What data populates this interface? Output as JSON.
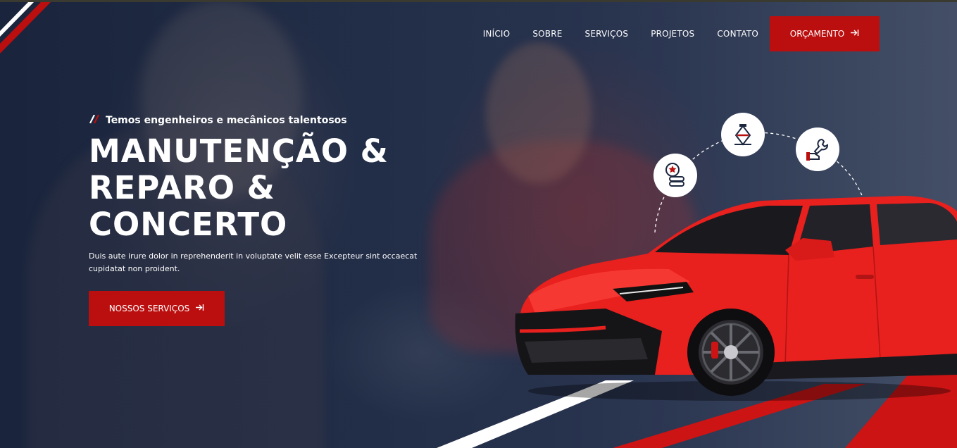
{
  "nav": {
    "items": [
      {
        "label": "INÍCIO"
      },
      {
        "label": "SOBRE"
      },
      {
        "label": "SERVIÇOS"
      },
      {
        "label": "PROJETOS"
      },
      {
        "label": "CONTATO"
      }
    ],
    "cta_label": "ORÇAMENTO",
    "cta_icon": "arrow-right-to-bracket-icon"
  },
  "hero": {
    "eyebrow": "Temos engenheiros e mecânicos talentosos",
    "title_line1": "MANUTENÇÃO &",
    "title_line2": "REPARO & CONCERTO",
    "description": "Duis aute irure dolor in reprehenderit in voluptate velit esse Excepteur sint occaecat cupidatat non proident.",
    "cta_label": "NOSSOS SERVIÇOS",
    "cta_icon": "arrow-right-to-bracket-icon"
  },
  "service_icons": [
    {
      "icon": "tires-icon"
    },
    {
      "icon": "car-jack-icon"
    },
    {
      "icon": "wrench-hand-icon"
    }
  ],
  "colors": {
    "accent": "#bb0f0f",
    "background": "#1f2a40",
    "car": "#e8201e",
    "text": "#ffffff"
  }
}
